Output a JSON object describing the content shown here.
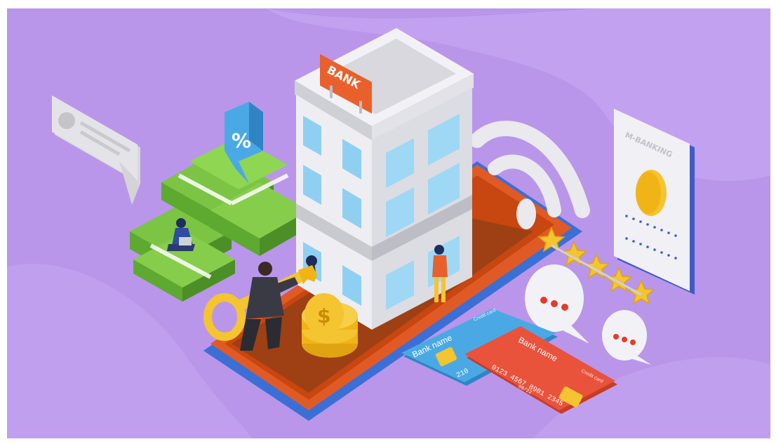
{
  "scene": {
    "background": "#b996ea",
    "background_light": "#c4a6f0",
    "bank_sign": "BANK",
    "percent_sign": "%",
    "coin_symbol": "$",
    "mbanking_label": "M-BANKING",
    "star_count": 5,
    "dots_icon": "•••"
  },
  "cards": {
    "blue_card": {
      "bank_name": "Bank name",
      "card_type": "Credit card",
      "number_fragment": "210"
    },
    "red_card": {
      "bank_name": "Bank name",
      "card_type": "Credit card",
      "number": "0123 4567 8901 2345",
      "valid_thru": "08/22"
    }
  },
  "colors": {
    "accent_orange": "#e8612c",
    "card_blue": "#4aa9e4",
    "card_red": "#e9523b",
    "money_green": "#7cc443",
    "gold": "#f4c431"
  }
}
